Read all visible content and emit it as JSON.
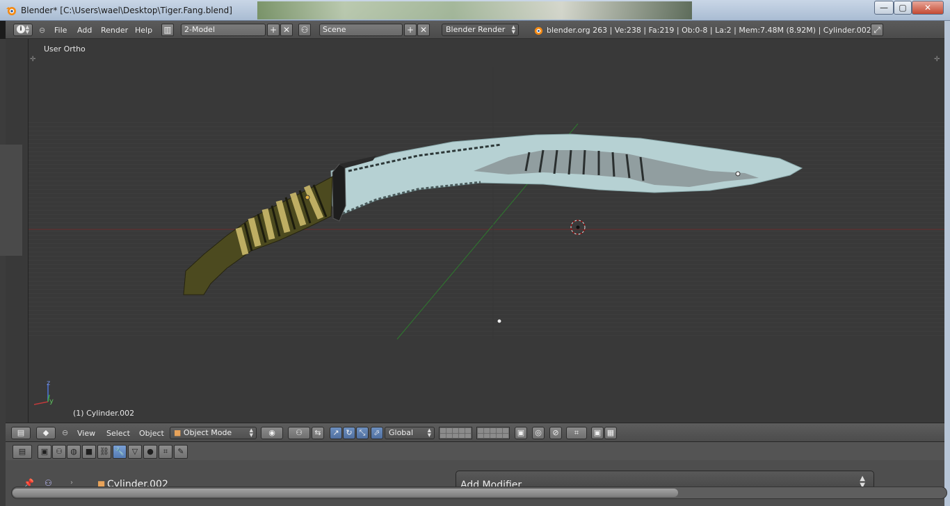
{
  "window": {
    "title": "Blender* [C:\\Users\\wael\\Desktop\\Tiger.Fang.blend]",
    "minimize_glyph": "—",
    "maximize_glyph": "▢",
    "close_glyph": "✕"
  },
  "info_header": {
    "menus": [
      "File",
      "Add",
      "Render",
      "Help"
    ],
    "screen_layout": "2-Model",
    "scene": "Scene",
    "render_engine": "Blender Render",
    "stats": "blender.org 263 | Ve:238 | Fa:219 | Ob:0-8 | La:2 | Mem:7.48M (8.92M) | Cylinder.002",
    "add_glyph": "+",
    "remove_glyph": "✕"
  },
  "viewport": {
    "view_label": "User Ortho",
    "object_label": "(1) Cylinder.002"
  },
  "viewport_header": {
    "menus": [
      "View",
      "Select",
      "Object"
    ],
    "mode": "Object Mode",
    "orientation": "Global"
  },
  "properties": {
    "object_name": "Cylinder.002",
    "add_modifier_label": "Add Modifier"
  },
  "colors": {
    "accent": "#5680c2",
    "grid_red_axis": "#6b2d2d",
    "grid_green_axis": "#2e7a2e",
    "blade": "#b8d3d4",
    "handle": "#4d4a1f"
  }
}
